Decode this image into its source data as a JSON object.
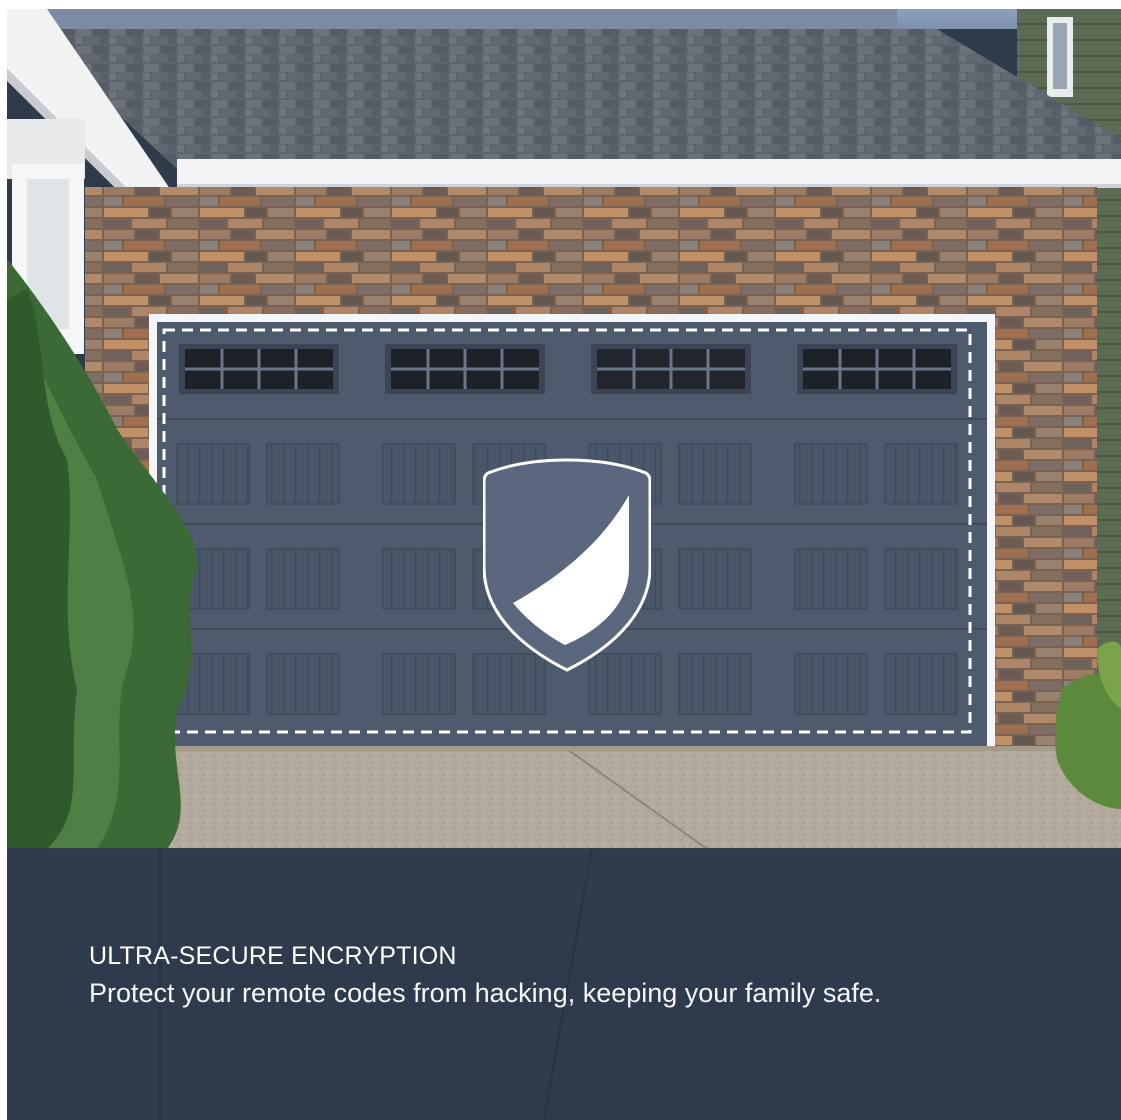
{
  "scene": {
    "description_icon": "shield-icon",
    "colors": {
      "door": "#4e5a6e",
      "door_panel": "#475467",
      "roof": "#5f6670",
      "stone": "#8a6e5a",
      "trim": "#eef0f2",
      "shrub": "#3f6b3a",
      "driveway": "#b7aea2",
      "shield_fill": "#56637a",
      "shield_stroke": "#ffffff",
      "dashed_outline": "#ffffff"
    }
  },
  "caption": {
    "headline": "ULTRA-SECURE ENCRYPTION",
    "subline": "Protect your remote codes from hacking, keeping your family safe.",
    "panel_color": "#2f3a4b",
    "text_color": "#ffffff"
  }
}
